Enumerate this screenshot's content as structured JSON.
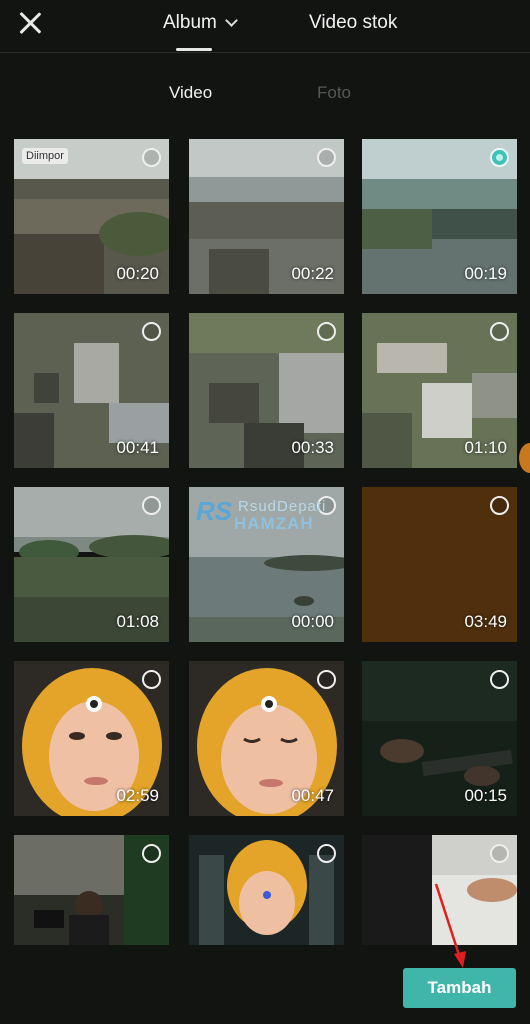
{
  "header": {
    "close_icon": "close-icon",
    "album_label": "Album",
    "stock_label": "Video stok"
  },
  "subtabs": {
    "video_label": "Video",
    "photo_label": "Foto"
  },
  "grid": {
    "items": [
      {
        "duration": "00:20",
        "badge": "Diimpor",
        "selected": false
      },
      {
        "duration": "00:22",
        "selected": false
      },
      {
        "duration": "00:19",
        "selected": true
      },
      {
        "duration": "00:41",
        "selected": false
      },
      {
        "duration": "00:33",
        "selected": false
      },
      {
        "duration": "01:10",
        "selected": false
      },
      {
        "duration": "01:08",
        "selected": false
      },
      {
        "duration": "00:00",
        "selected": false
      },
      {
        "duration": "03:49",
        "selected": false
      },
      {
        "duration": "02:59",
        "selected": false
      },
      {
        "duration": "00:47",
        "selected": false
      },
      {
        "duration": "00:15",
        "selected": false
      },
      {
        "duration": "",
        "selected": false
      },
      {
        "duration": "",
        "selected": false
      },
      {
        "duration": "",
        "selected": false
      }
    ]
  },
  "watermark": {
    "logo": "RS",
    "line1": "RsudDepati",
    "line2": "HAMZAH"
  },
  "footer": {
    "add_label": "Tambah"
  },
  "colors": {
    "accent": "#3fb6a9",
    "background": "#121412"
  }
}
